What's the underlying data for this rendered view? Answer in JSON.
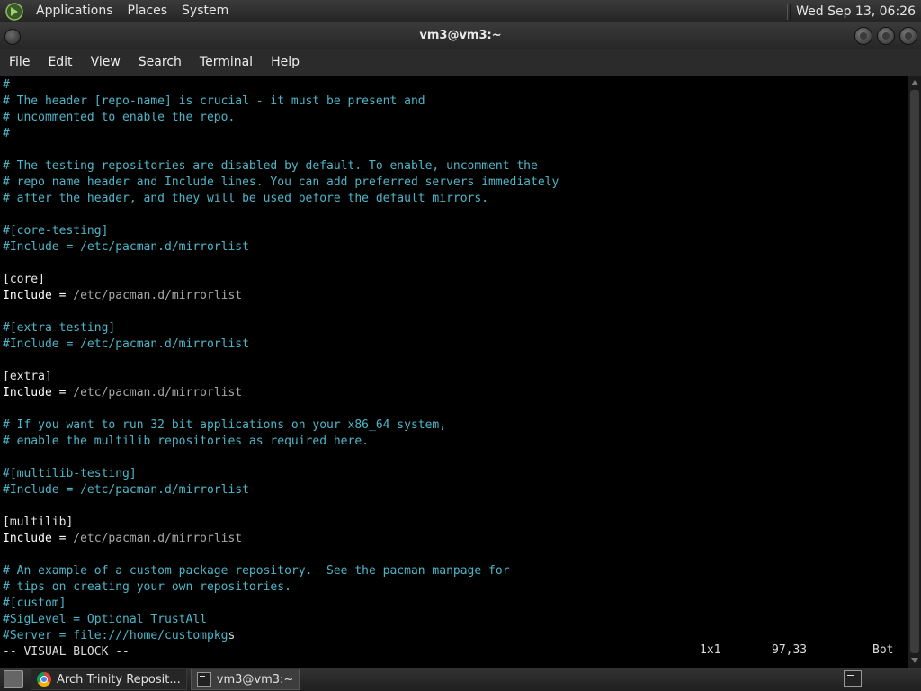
{
  "top_panel": {
    "menus": [
      "Applications",
      "Places",
      "System"
    ],
    "clock": "Wed Sep 13, 06:26"
  },
  "window": {
    "title": "vm3@vm3:~",
    "menu": [
      "File",
      "Edit",
      "View",
      "Search",
      "Terminal",
      "Help"
    ]
  },
  "terminal": {
    "lines": [
      {
        "segs": [
          {
            "t": "#",
            "c": "comment"
          }
        ]
      },
      {
        "segs": [
          {
            "t": "# The header [repo-name] is crucial - it must be present and",
            "c": "comment"
          }
        ]
      },
      {
        "segs": [
          {
            "t": "# uncommented to enable the repo.",
            "c": "comment"
          }
        ]
      },
      {
        "segs": [
          {
            "t": "#",
            "c": "comment"
          }
        ]
      },
      {
        "segs": []
      },
      {
        "segs": [
          {
            "t": "# The testing repositories are disabled by default. To enable, uncomment the",
            "c": "comment"
          }
        ]
      },
      {
        "segs": [
          {
            "t": "# repo name header and Include lines. You can add preferred servers immediately",
            "c": "comment"
          }
        ]
      },
      {
        "segs": [
          {
            "t": "# after the header, and they will be used before the default mirrors.",
            "c": "comment"
          }
        ]
      },
      {
        "segs": []
      },
      {
        "segs": [
          {
            "t": "#[core-testing]",
            "c": "comment"
          }
        ]
      },
      {
        "segs": [
          {
            "t": "#Include = /etc/pacman.d/mirrorlist",
            "c": "comment"
          }
        ]
      },
      {
        "segs": []
      },
      {
        "segs": [
          {
            "t": "[core]",
            "c": "section"
          }
        ]
      },
      {
        "segs": [
          {
            "t": "Include = ",
            "c": "key"
          },
          {
            "t": "/etc/pacman.d/mirrorlist",
            "c": "path"
          }
        ]
      },
      {
        "segs": []
      },
      {
        "segs": [
          {
            "t": "#[extra-testing]",
            "c": "comment"
          }
        ]
      },
      {
        "segs": [
          {
            "t": "#Include = /etc/pacman.d/mirrorlist",
            "c": "comment"
          }
        ]
      },
      {
        "segs": []
      },
      {
        "segs": [
          {
            "t": "[extra]",
            "c": "section"
          }
        ]
      },
      {
        "segs": [
          {
            "t": "Include = ",
            "c": "key"
          },
          {
            "t": "/etc/pacman.d/mirrorlist",
            "c": "path"
          }
        ]
      },
      {
        "segs": []
      },
      {
        "segs": [
          {
            "t": "# If you want to run 32 bit applications on your x86_64 system,",
            "c": "comment"
          }
        ]
      },
      {
        "segs": [
          {
            "t": "# enable the multilib repositories as required here.",
            "c": "comment"
          }
        ]
      },
      {
        "segs": []
      },
      {
        "segs": [
          {
            "t": "#[multilib-testing]",
            "c": "comment"
          }
        ]
      },
      {
        "segs": [
          {
            "t": "#Include = /etc/pacman.d/mirrorlist",
            "c": "comment"
          }
        ]
      },
      {
        "segs": []
      },
      {
        "segs": [
          {
            "t": "[multilib]",
            "c": "section"
          }
        ]
      },
      {
        "segs": [
          {
            "t": "Include = ",
            "c": "key"
          },
          {
            "t": "/etc/pacman.d/mirrorlist",
            "c": "path"
          }
        ]
      },
      {
        "segs": []
      },
      {
        "segs": [
          {
            "t": "# An example of a custom package repository.  See the pacman manpage for",
            "c": "comment"
          }
        ]
      },
      {
        "segs": [
          {
            "t": "# tips on creating your own repositories.",
            "c": "comment"
          }
        ]
      },
      {
        "segs": [
          {
            "t": "#[custom]",
            "c": "comment"
          }
        ]
      },
      {
        "segs": [
          {
            "t": "#SigLevel = Optional TrustAll",
            "c": "comment"
          }
        ]
      },
      {
        "segs": [
          {
            "t": "#Server = file:///home/custompkg",
            "c": "comment"
          },
          {
            "t": "s",
            "c": "cursor"
          }
        ]
      },
      {
        "segs": [
          {
            "t": "-- VISUAL BLOCK --",
            "c": "status"
          }
        ]
      }
    ],
    "status_selection": "1x1",
    "status_position": "97,33",
    "status_scroll": "Bot"
  },
  "taskbar": {
    "tasks": [
      {
        "label": "Arch Trinity Reposit...",
        "icon": "chrome-icon",
        "active": false
      },
      {
        "label": "vm3@vm3:~",
        "icon": "terminal-icon",
        "active": true
      }
    ]
  },
  "colors": {
    "comment": "#4db6c9",
    "cursor": "#4dd3e6",
    "path": "#a8a8a8"
  }
}
